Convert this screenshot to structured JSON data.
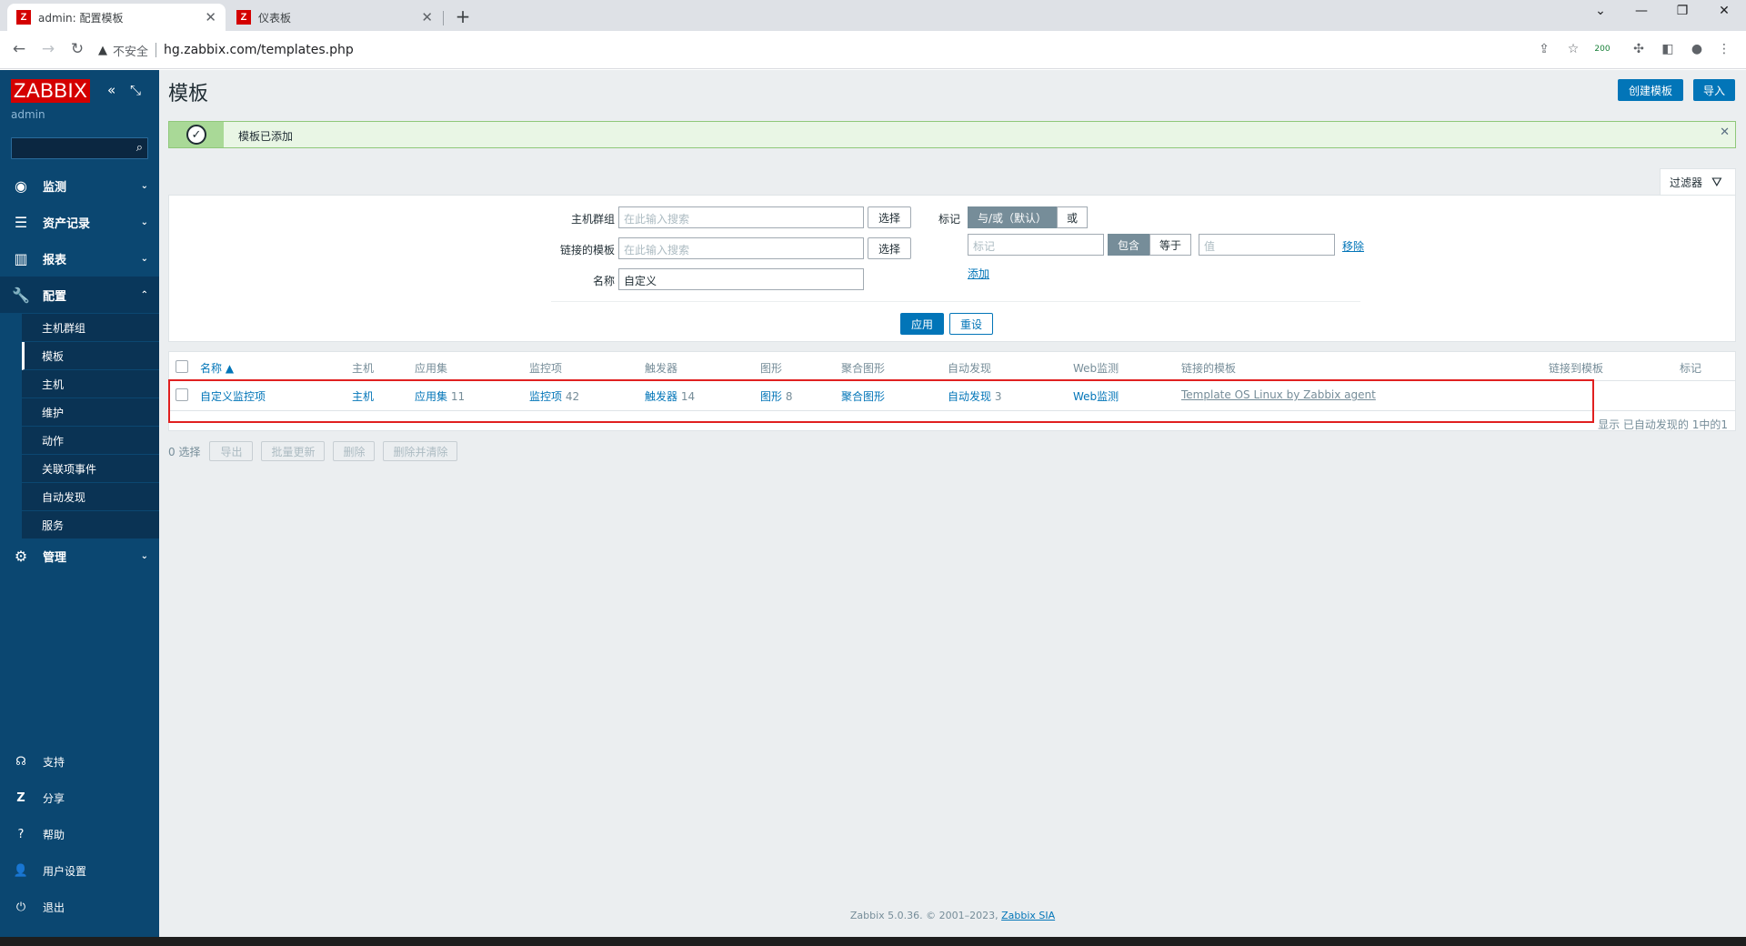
{
  "browser": {
    "tabs": [
      {
        "title": "admin: 配置模板",
        "active": true
      },
      {
        "title": "仪表板",
        "active": false
      }
    ],
    "insecure_label": "不安全",
    "url": "hg.zabbix.com/templates.php",
    "ext_badge": "200"
  },
  "sidebar": {
    "logo": "ZABBIX",
    "user": "admin",
    "menu": [
      {
        "label": "监测",
        "icon": "eye-icon"
      },
      {
        "label": "资产记录",
        "icon": "list-icon"
      },
      {
        "label": "报表",
        "icon": "bar-chart-icon"
      },
      {
        "label": "配置",
        "icon": "wrench-icon"
      },
      {
        "label": "管理",
        "icon": "gear-icon"
      }
    ],
    "config_submenu": [
      "主机群组",
      "模板",
      "主机",
      "维护",
      "动作",
      "关联项事件",
      "自动发现",
      "服务"
    ],
    "bottom": [
      {
        "label": "支持",
        "icon": "headset-icon"
      },
      {
        "label": "分享",
        "icon": "zabbix-share-icon"
      },
      {
        "label": "帮助",
        "icon": "question-icon"
      },
      {
        "label": "用户设置",
        "icon": "user-icon"
      },
      {
        "label": "退出",
        "icon": "power-icon"
      }
    ]
  },
  "header": {
    "title": "模板",
    "create_button": "创建模板",
    "import_button": "导入"
  },
  "message": {
    "text": "模板已添加"
  },
  "filter": {
    "tab_label": "过滤器",
    "host_groups_label": "主机群组",
    "host_groups_placeholder": "在此输入搜索",
    "linked_templates_label": "链接的模板",
    "linked_templates_placeholder": "在此输入搜索",
    "select_label": "选择",
    "name_label": "名称",
    "name_value": "自定义",
    "tags_label": "标记",
    "tags_andor": "与/或（默认）",
    "tags_or": "或",
    "tag_placeholder": "标记",
    "contains": "包含",
    "equals": "等于",
    "value_placeholder": "值",
    "remove": "移除",
    "add": "添加",
    "apply": "应用",
    "reset": "重设"
  },
  "table": {
    "headers": [
      "名称 ▲",
      "主机",
      "应用集",
      "监控项",
      "触发器",
      "图形",
      "聚合图形",
      "自动发现",
      "Web监测",
      "链接的模板",
      "链接到模板",
      "标记"
    ],
    "row": {
      "name": "自定义监控项",
      "hosts": "主机",
      "applications": "应用集",
      "applications_count": "11",
      "items": "监控项",
      "items_count": "42",
      "triggers": "触发器",
      "triggers_count": "14",
      "graphs": "图形",
      "graphs_count": "8",
      "screens": "聚合图形",
      "discovery": "自动发现",
      "discovery_count": "3",
      "web": "Web监测",
      "linked_templates": "Template OS Linux by Zabbix agent"
    },
    "footer_count": "显示 已自动发现的 1中的1"
  },
  "actions": {
    "selected": "0 选择",
    "buttons": [
      "导出",
      "批量更新",
      "删除",
      "删除并清除"
    ]
  },
  "footer": {
    "text": "Zabbix 5.0.36. © 2001–2023, ",
    "link": "Zabbix SIA"
  },
  "colors": {
    "sidebar": "#0b4771",
    "logo": "#d40000",
    "primary": "#0275b8",
    "highlight": "#e02020"
  }
}
